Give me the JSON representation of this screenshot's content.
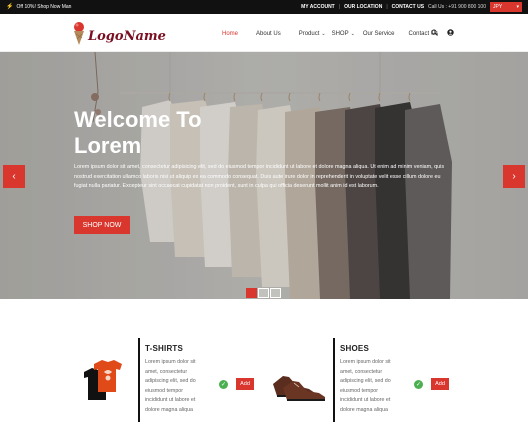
{
  "topbar": {
    "promo": "Off 10%! Shop Now Man",
    "links": [
      "MY ACCOUNT",
      "OUR LOCATION",
      "CONTACT US"
    ],
    "call": "Call Us : +91 900 800 100",
    "currency": "JPY"
  },
  "header": {
    "logo_text": "LogoName",
    "nav": [
      "Home",
      "About Us",
      "Product",
      "SHOP",
      "Our Service",
      "Contact Us"
    ]
  },
  "hero": {
    "title": "Welcome To Lorem",
    "description": "Lorem ipsum dolor sit amet, consectetur adipisicing elit, sed do eiusmod tempor incididunt ut labore et dolore magna aliqua. Ut enim ad minim veniam, quis nostrud exercitation ullamco laboris nisi ut aliquip ex ea commodo consequat. Duis aute irure dolor in reprehenderit in voluptate velit esse cillum dolore eu fugiat nulla pariatur. Excepteur sint occaecat cupidatat non proident, sunt in culpa qui officia deserunt mollit anim id est laborum.",
    "cta": "SHOP NOW",
    "prev_glyph": "‹",
    "next_glyph": "›"
  },
  "products": [
    {
      "name": "T-SHIRTS",
      "description": "Lorem ipsum dolor sit amet, consectetur adipiscing elit, sed do eiusmod tempor incididunt ut labore et dolore magna aliqua",
      "add_label": "Add"
    },
    {
      "name": "SHOES",
      "description": "Lorem ipsum dolor sit amet, consectetur adipiscing elit, sed do eiusmod tempor incididunt ut labore et dolore magna aliqua",
      "add_label": "Add"
    }
  ],
  "icons": {
    "search": "search-icon",
    "user": "user-icon",
    "check": "check-icon"
  },
  "colors": {
    "accent": "#d9362e",
    "topbar": "#111111",
    "logo": "#7a0f22",
    "check": "#4caf50"
  }
}
